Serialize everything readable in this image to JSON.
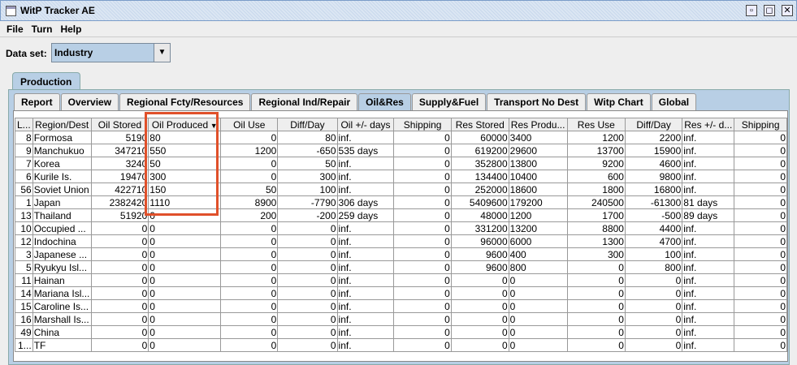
{
  "window": {
    "title": "WitP Tracker AE"
  },
  "menu": [
    {
      "label": "File"
    },
    {
      "label": "Turn"
    },
    {
      "label": "Help"
    }
  ],
  "dataset": {
    "label": "Data set:",
    "value": "Industry"
  },
  "outer_tab": "Production",
  "tabs": [
    "Report",
    "Overview",
    "Regional Fcty/Resources",
    "Regional Ind/Repair",
    "Oil&Res",
    "Supply&Fuel",
    "Transport No Dest",
    "Witp Chart",
    "Global"
  ],
  "active_tab": "Oil&Res",
  "columns": [
    "L...",
    "Region/Dest",
    "Oil Stored",
    "Oil Produced",
    "Oil Use",
    "Diff/Day",
    "Oil +/- days",
    "Shipping",
    "Res Stored",
    "Res Produ...",
    "Res Use",
    "Diff/Day",
    "Res +/- d...",
    "Shipping"
  ],
  "sort_column": "Oil Produced",
  "rows": [
    [
      "8",
      "Formosa",
      "5190",
      "80",
      "0",
      "80",
      "inf.",
      "0",
      "60000",
      "3400",
      "1200",
      "2200",
      "inf.",
      "0"
    ],
    [
      "9",
      "Manchukuo",
      "347210",
      "550",
      "1200",
      "-650",
      "535 days",
      "0",
      "619200",
      "29600",
      "13700",
      "15900",
      "inf.",
      "0"
    ],
    [
      "7",
      "Korea",
      "3240",
      "50",
      "0",
      "50",
      "inf.",
      "0",
      "352800",
      "13800",
      "9200",
      "4600",
      "inf.",
      "0"
    ],
    [
      "6",
      "Kurile Is.",
      "19470",
      "300",
      "0",
      "300",
      "inf.",
      "0",
      "134400",
      "10400",
      "600",
      "9800",
      "inf.",
      "0"
    ],
    [
      "56",
      "Soviet Union",
      "422710",
      "150",
      "50",
      "100",
      "inf.",
      "0",
      "252000",
      "18600",
      "1800",
      "16800",
      "inf.",
      "0"
    ],
    [
      "1",
      "Japan",
      "2382420",
      "1110",
      "8900",
      "-7790",
      "306 days",
      "0",
      "5409600",
      "179200",
      "240500",
      "-61300",
      "81 days",
      "0"
    ],
    [
      "13",
      "Thailand",
      "51920",
      "0",
      "200",
      "-200",
      "259 days",
      "0",
      "48000",
      "1200",
      "1700",
      "-500",
      "89 days",
      "0"
    ],
    [
      "10",
      "Occupied ...",
      "0",
      "0",
      "0",
      "0",
      "inf.",
      "0",
      "331200",
      "13200",
      "8800",
      "4400",
      "inf.",
      "0"
    ],
    [
      "12",
      "Indochina",
      "0",
      "0",
      "0",
      "0",
      "inf.",
      "0",
      "96000",
      "6000",
      "1300",
      "4700",
      "inf.",
      "0"
    ],
    [
      "3",
      "Japanese ...",
      "0",
      "0",
      "0",
      "0",
      "inf.",
      "0",
      "9600",
      "400",
      "300",
      "100",
      "inf.",
      "0"
    ],
    [
      "5",
      "Ryukyu Isl...",
      "0",
      "0",
      "0",
      "0",
      "inf.",
      "0",
      "9600",
      "800",
      "0",
      "800",
      "inf.",
      "0"
    ],
    [
      "11",
      "Hainan",
      "0",
      "0",
      "0",
      "0",
      "inf.",
      "0",
      "0",
      "0",
      "0",
      "0",
      "inf.",
      "0"
    ],
    [
      "14",
      "Mariana Isl...",
      "0",
      "0",
      "0",
      "0",
      "inf.",
      "0",
      "0",
      "0",
      "0",
      "0",
      "inf.",
      "0"
    ],
    [
      "15",
      "Caroline Is...",
      "0",
      "0",
      "0",
      "0",
      "inf.",
      "0",
      "0",
      "0",
      "0",
      "0",
      "inf.",
      "0"
    ],
    [
      "16",
      "Marshall Is...",
      "0",
      "0",
      "0",
      "0",
      "inf.",
      "0",
      "0",
      "0",
      "0",
      "0",
      "inf.",
      "0"
    ],
    [
      "49",
      "China",
      "0",
      "0",
      "0",
      "0",
      "inf.",
      "0",
      "0",
      "0",
      "0",
      "0",
      "inf.",
      "0"
    ],
    [
      "1...",
      "TF",
      "0",
      "0",
      "0",
      "0",
      "inf.",
      "0",
      "0",
      "0",
      "0",
      "0",
      "inf.",
      "0"
    ]
  ],
  "colors": {
    "highlight": "#e0502a",
    "selected_tab": "#b8cfe5"
  }
}
